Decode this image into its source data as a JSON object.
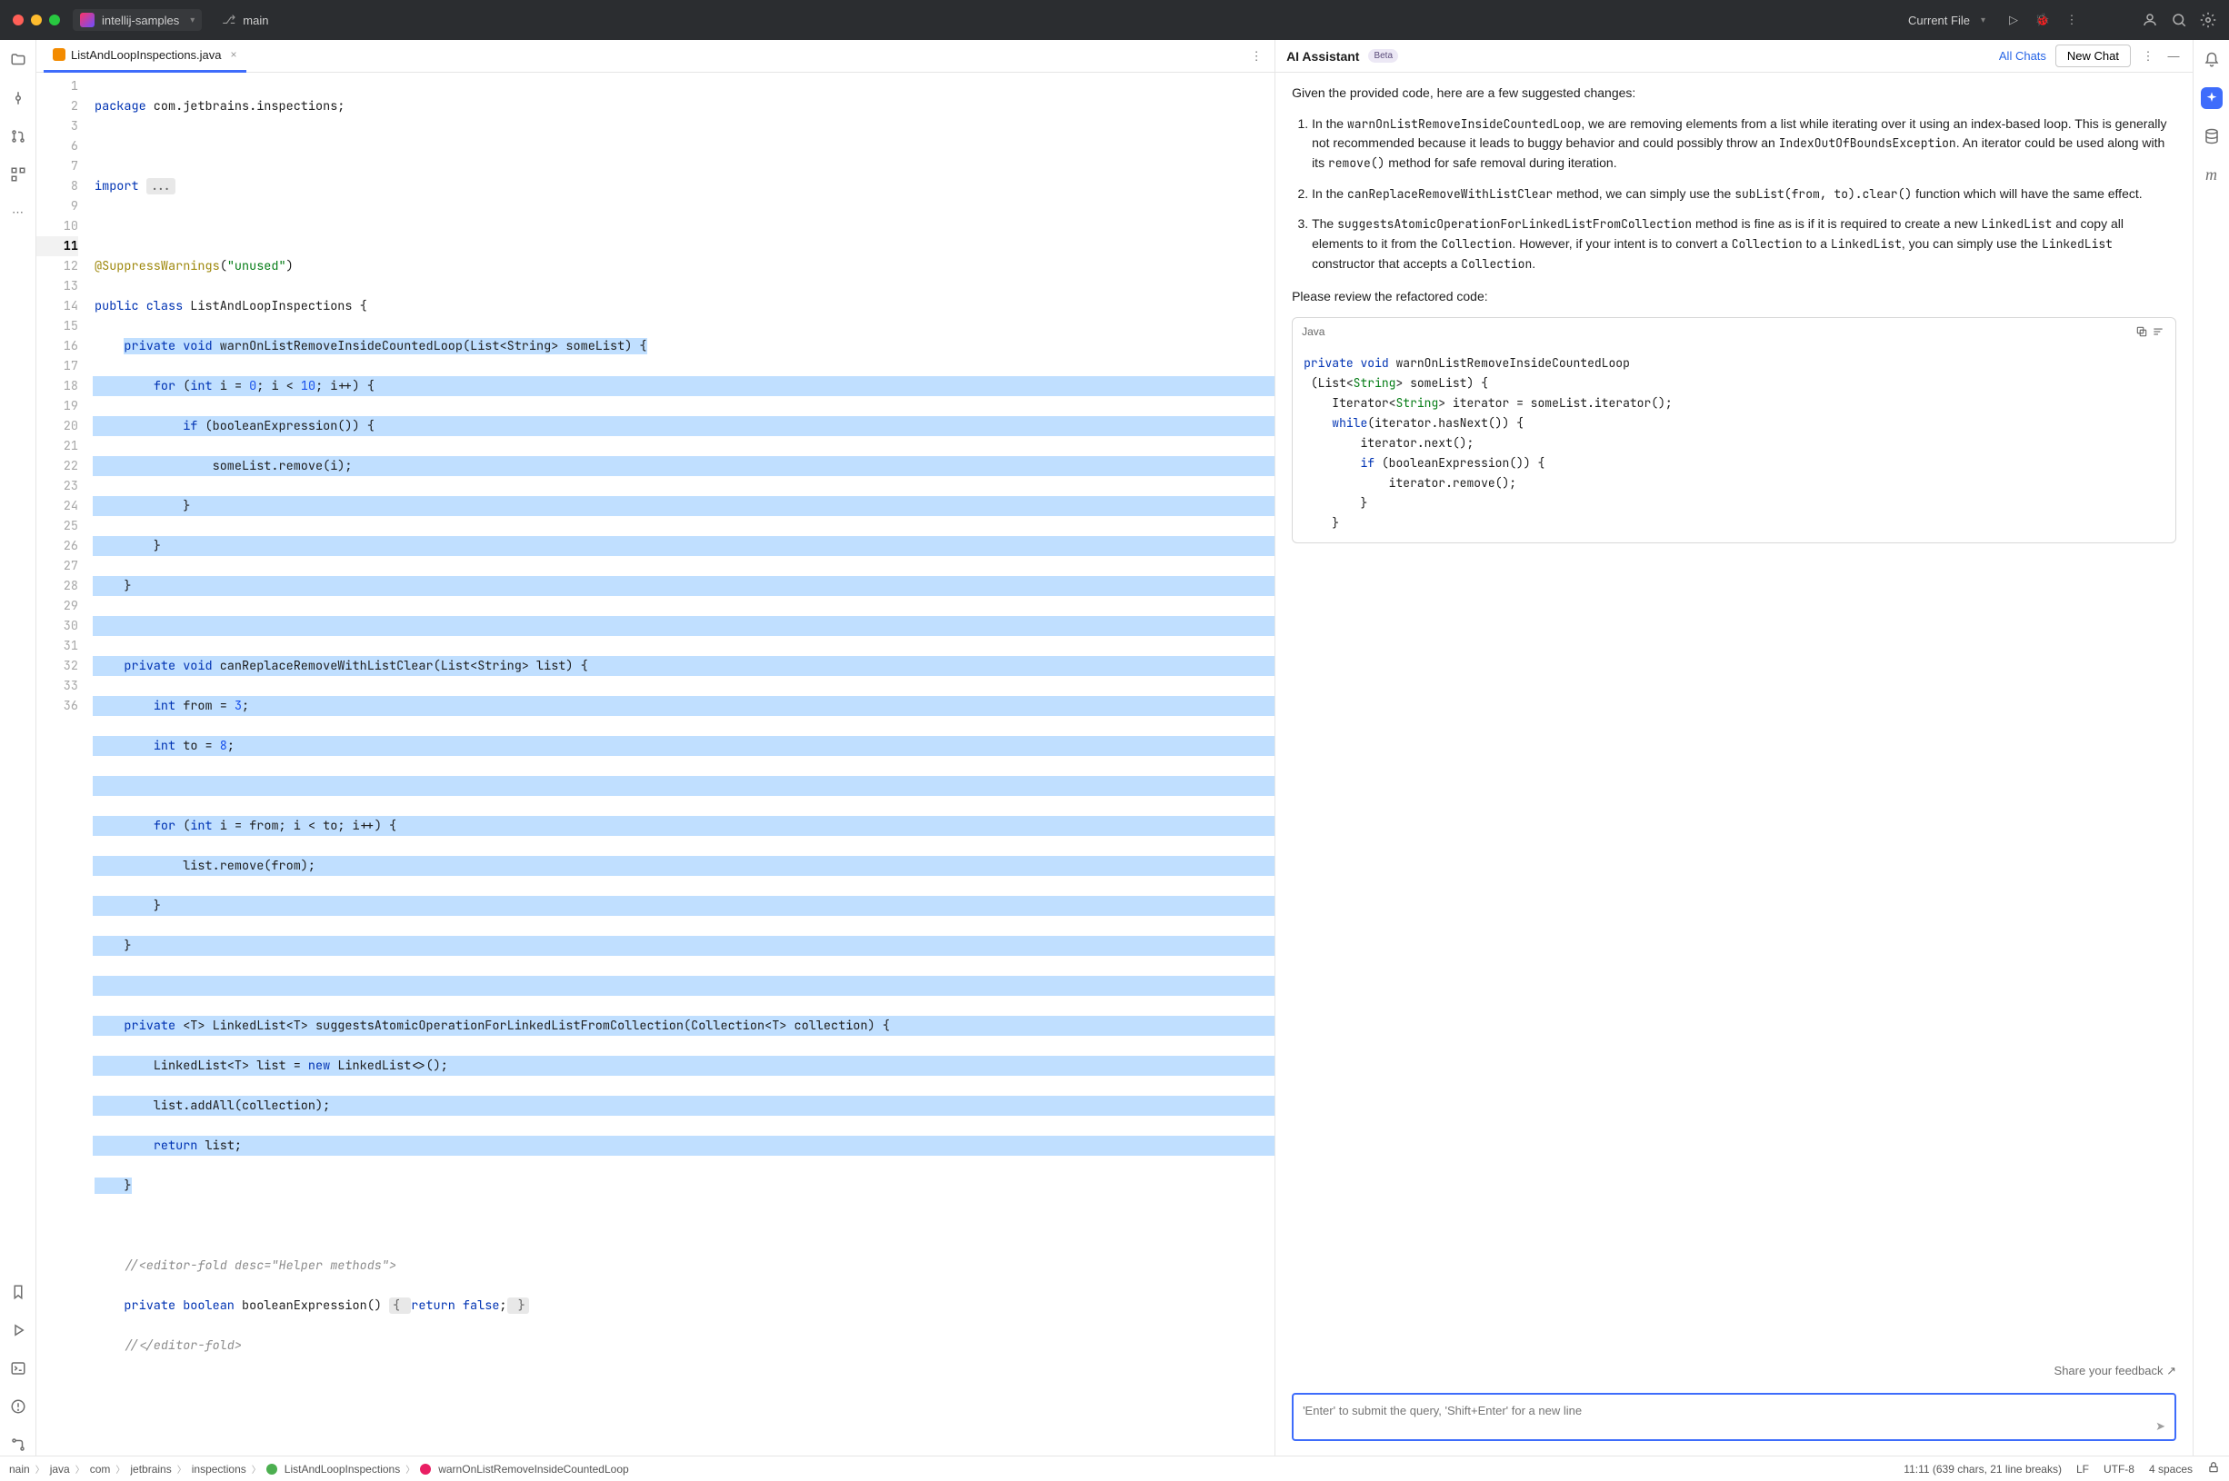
{
  "titlebar": {
    "project": "intellij-samples",
    "branch": "main",
    "run_config": "Current File"
  },
  "tabs": {
    "active": "ListAndLoopInspections.java"
  },
  "gutter_lines": [
    "1",
    "2",
    "3",
    "6",
    "7",
    "8",
    "9",
    "10",
    "11",
    "12",
    "13",
    "14",
    "15",
    "16",
    "17",
    "18",
    "19",
    "20",
    "21",
    "22",
    "23",
    "24",
    "25",
    "26",
    "27",
    "28",
    "29",
    "30",
    "31",
    "32",
    "33",
    "36"
  ],
  "code": {
    "l1a": "package",
    "l1b": " com.jetbrains.inspections;",
    "l3a": "import",
    "l3b": " ",
    "l3c": "...",
    "l7a": "@SuppressWarnings",
    "l7b": "(",
    "l7c": "\"unused\"",
    "l7d": ")",
    "l8a": "public class",
    "l8b": " ListAndLoopInspections {",
    "l9a": "    ",
    "l9b": "private void",
    "l9c": " warnOnListRemoveInsideCountedLoop(List<String> someList) {",
    "l10a": "        ",
    "l10b": "for",
    "l10c": " (",
    "l10d": "int",
    "l10e": " i = ",
    "l10f": "0",
    "l10g": "; i < ",
    "l10h": "10",
    "l10i": "; i++) {",
    "l11a": "            ",
    "l11b": "if",
    "l11c": " (booleanExpression()) {",
    "l12": "                someList.remove(i);",
    "l13": "            }",
    "l14": "        }",
    "l15": "    }",
    "l17a": "    ",
    "l17b": "private void",
    "l17c": " canReplaceRemoveWithListClear(List<String> list) {",
    "l18a": "        ",
    "l18b": "int",
    "l18c": " from = ",
    "l18d": "3",
    "l18e": ";",
    "l19a": "        ",
    "l19b": "int",
    "l19c": " to = ",
    "l19d": "8",
    "l19e": ";",
    "l21a": "        ",
    "l21b": "for",
    "l21c": " (",
    "l21d": "int",
    "l21e": " i = from; i < to; i++) {",
    "l22": "            list.remove(from);",
    "l23": "        }",
    "l24": "    }",
    "l26a": "    ",
    "l26b": "private",
    "l26c": " <T> LinkedList<T> suggestsAtomicOperationForLinkedListFromCollection(Collection<T> collection) {",
    "l27a": "        LinkedList<T> list = ",
    "l27b": "new",
    "l27c": " LinkedList<>();",
    "l28": "        list.addAll(collection);",
    "l29a": "        ",
    "l29b": "return",
    "l29c": " list;",
    "l30": "    }",
    "l32a": "    ",
    "l32b": "//<editor-fold desc=\"Helper methods\">",
    "l33a": "    ",
    "l33b": "private boolean",
    "l33c": " booleanExpression() ",
    "l33d": "{ ",
    "l33e": "return false",
    "l33f": ";",
    "l33g": " }",
    "l36a": "    ",
    "l36b": "//</editor-fold>"
  },
  "assistant": {
    "title": "AI Assistant",
    "beta": "Beta",
    "all_chats": "All Chats",
    "new_chat": "New Chat",
    "intro": "Given the provided code, here are a few suggested changes:",
    "li1_a": "In the ",
    "li1_code1": "warnOnListRemoveInsideCountedLoop",
    "li1_b": ", we are removing elements from a list while iterating over it using an index-based loop. This is generally not recommended because it leads to buggy behavior and could possibly throw an ",
    "li1_code2": "IndexOutOfBoundsException",
    "li1_c": ". An iterator could be used along with its ",
    "li1_code3": "remove()",
    "li1_d": " method for safe removal during iteration.",
    "li2_a": "In the ",
    "li2_code1": "canReplaceRemoveWithListClear",
    "li2_b": " method, we can simply use the ",
    "li2_code2": "subList(from, to).clear()",
    "li2_c": " function which will have the same effect.",
    "li3_a": "The ",
    "li3_code1": "suggestsAtomicOperationForLinkedListFromCollection",
    "li3_b": " method is fine as is if it is required to create a new ",
    "li3_code2": "LinkedList",
    "li3_c": " and copy all elements to it from the ",
    "li3_code3": "Collection",
    "li3_d": ". However, if your intent is to convert a ",
    "li3_code4": "Collection",
    "li3_e": " to a ",
    "li3_code5": "LinkedList",
    "li3_f": ", you can simply use the ",
    "li3_code6": "LinkedList",
    "li3_g": " constructor that accepts a ",
    "li3_code7": "Collection",
    "li3_h": ".",
    "review": "Please review the refactored code:",
    "cb_lang": "Java",
    "cb1": "private void",
    "cb1b": " warnOnListRemoveInsideCountedLoop",
    "cb2a": " (List<",
    "cb2b": "String",
    "cb2c": "> someList) {",
    "cb3a": "    Iterator<",
    "cb3b": "String",
    "cb3c": "> iterator = someList.iterator();",
    "cb4a": "    ",
    "cb4b": "while",
    "cb4c": "(iterator.hasNext()) {",
    "cb5": "        iterator.next();",
    "cb6a": "        ",
    "cb6b": "if",
    "cb6c": " (booleanExpression()) {",
    "cb7": "            iterator.remove();",
    "cb8": "        }",
    "cb9": "    }",
    "feedback": "Share your feedback ↗",
    "placeholder": "'Enter' to submit the query, 'Shift+Enter' for a new line"
  },
  "breadcrumbs": [
    "nain",
    "java",
    "com",
    "jetbrains",
    "inspections",
    "ListAndLoopInspections",
    "warnOnListRemoveInsideCountedLoop"
  ],
  "status": {
    "position": "11:11 (639 chars, 21 line breaks)",
    "lf": "LF",
    "encoding": "UTF-8",
    "indent": "4 spaces"
  }
}
